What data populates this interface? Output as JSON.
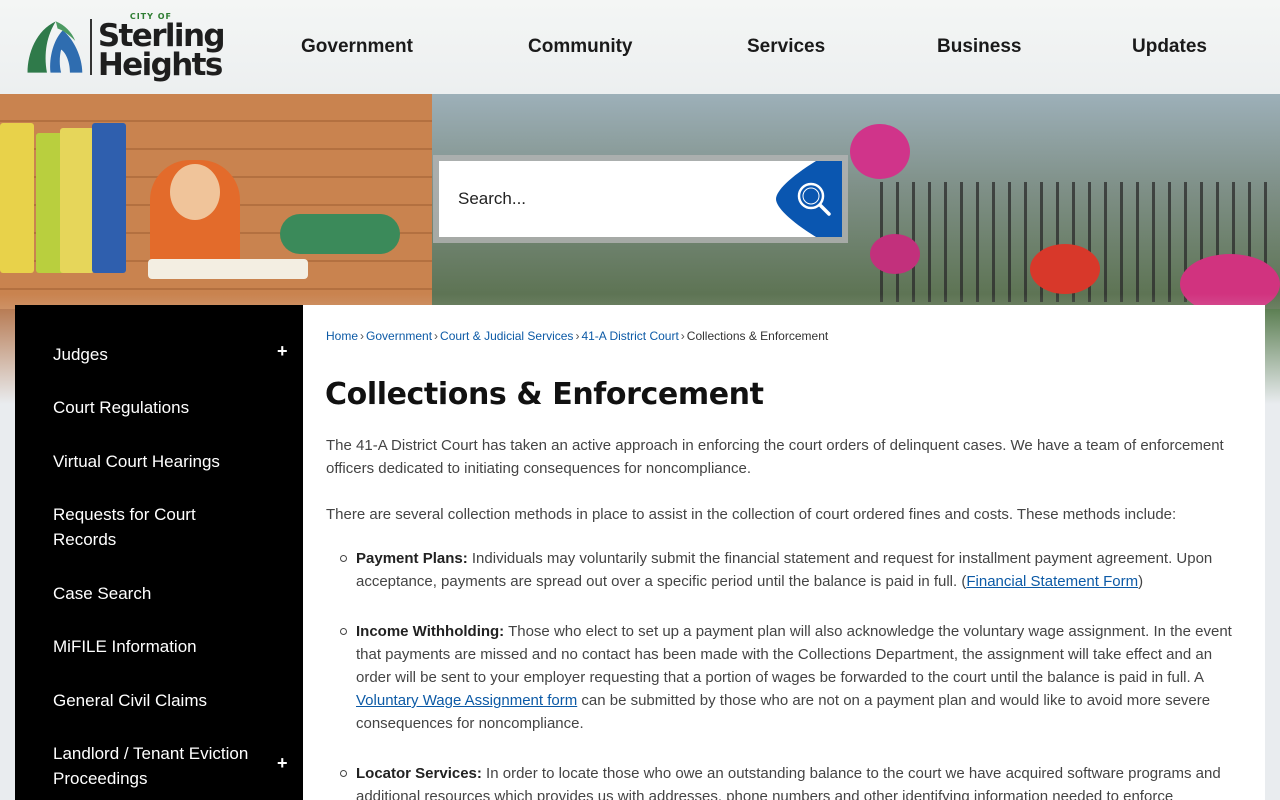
{
  "header": {
    "logo": {
      "city": "CITY OF",
      "name_line1": "Sterling",
      "name_line2": "Heights"
    },
    "nav": [
      "Government",
      "Community",
      "Services",
      "Business",
      "Updates"
    ]
  },
  "search": {
    "placeholder": "Search..."
  },
  "sidebar": {
    "items": [
      {
        "label": "Judges",
        "expandable": true
      },
      {
        "label": "Court Regulations",
        "expandable": false
      },
      {
        "label": "Virtual Court Hearings",
        "expandable": false
      },
      {
        "label": "Requests for Court Records",
        "expandable": false
      },
      {
        "label": "Case Search",
        "expandable": false
      },
      {
        "label": "MiFILE Information",
        "expandable": false
      },
      {
        "label": "General Civil Claims",
        "expandable": false
      },
      {
        "label": "Landlord / Tenant Eviction Proceedings",
        "expandable": true
      }
    ],
    "expand_symbol": "+"
  },
  "breadcrumb": {
    "links": [
      "Home",
      "Government",
      "Court & Judicial Services",
      "41-A District Court"
    ],
    "current": "Collections & Enforcement",
    "separator": "›"
  },
  "main": {
    "title": "Collections & Enforcement",
    "intro": "The 41-A District Court has taken an active approach in enforcing the court orders of delinquent cases. We have a team of enforcement officers dedicated to initiating consequences for noncompliance.",
    "methods_intro": "There are several collection methods in place to assist in the collection of court ordered fines and costs. These methods include:",
    "bullets": [
      {
        "title": "Payment Plans:",
        "text_before": " Individuals may voluntarily submit the financial statement and request for installment payment agreement. Upon acceptance, payments are spread out over a specific period until the balance is paid in full. (",
        "link": "Financial Statement Form",
        "text_after": ")"
      },
      {
        "title": "Income Withholding:",
        "text_before": " Those who elect to set up a payment plan will also acknowledge the voluntary wage assignment. In the event that payments are missed and no contact has been made with the Collections Department, the assignment will take effect and an order will be sent to your employer requesting that a portion of wages be forwarded to the court until the balance is paid in full. A ",
        "link": "Voluntary Wage Assignment form",
        "text_after": " can be submitted by those who are not on a payment plan and would like to avoid more severe consequences for noncompliance."
      },
      {
        "title": "Locator Services:",
        "text_before": " In order to locate those who owe an outstanding balance to the court we have acquired software programs and additional resources which provides us with addresses, phone numbers and other identifying information needed to enforce",
        "link": "",
        "text_after": ""
      }
    ]
  },
  "colors": {
    "sidebar_bg": "#000000",
    "link": "#0c5aa6",
    "search_button": "#0a56b0",
    "logo_green": "#2e7d32"
  }
}
